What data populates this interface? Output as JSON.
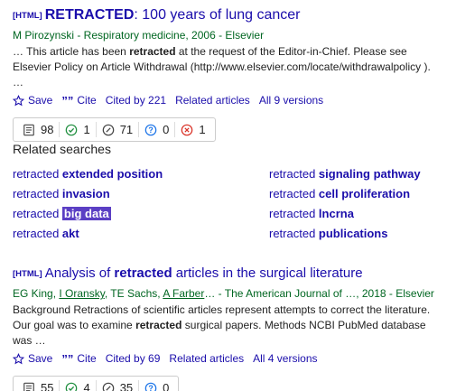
{
  "result1": {
    "tag": "[HTML]",
    "title_bold": "RETRACTED",
    "title_rest": ": 100 years of lung cancer",
    "meta": "M Pirozynski - Respiratory medicine, 2006 - Elsevier",
    "snippet_a": "… This article has been ",
    "snippet_bold": "retracted",
    "snippet_b": " at the request of the Editor-in-Chief. Please see Elsevier Policy on Article Withdrawal (http://www.elsevier.com/locate/withdrawalpolicy ). …",
    "save": "Save",
    "cite": "Cite",
    "cited_by": "Cited by 221",
    "related": "Related articles",
    "versions": "All 9 versions",
    "badges": [
      "98",
      "1",
      "71",
      "0",
      "1"
    ]
  },
  "related_searches": {
    "heading": "Related searches",
    "items": [
      {
        "prefix": "retracted ",
        "term": "extended position"
      },
      {
        "prefix": "retracted ",
        "term": "signaling pathway"
      },
      {
        "prefix": "retracted ",
        "term": "invasion"
      },
      {
        "prefix": "retracted ",
        "term": "cell proliferation"
      },
      {
        "prefix": "retracted ",
        "term": "big data"
      },
      {
        "prefix": "retracted ",
        "term": "lncrna"
      },
      {
        "prefix": "retracted ",
        "term": "akt"
      },
      {
        "prefix": "retracted ",
        "term": "publications"
      }
    ]
  },
  "result2": {
    "tag": "[HTML]",
    "title_a": "Analysis of ",
    "title_bold": "retracted",
    "title_b": " articles in the surgical literature",
    "meta_a": "EG King, ",
    "author2": "I Oransky",
    "meta_b": ", TE Sachs, ",
    "author4": "A Farber",
    "meta_c": "… - The American Journal of …, 2018 - Elsevier",
    "snippet_a": "Background Retractions of scientific articles represent attempts to correct the literature. Our goal was to examine ",
    "snippet_bold": "retracted",
    "snippet_b": " surgical papers. Methods NCBI PubMed database was …",
    "save": "Save",
    "cite": "Cite",
    "cited_by": "Cited by 69",
    "related": "Related articles",
    "versions": "All 4 versions",
    "badges": [
      "55",
      "4",
      "35",
      "0"
    ]
  },
  "colors": {
    "link": "#1a0dab",
    "meta_green": "#006621",
    "highlight": "#5b3fc4",
    "check_green": "#1e8e3e",
    "question_blue": "#1a73e8",
    "x_red": "#d93025"
  },
  "icons": [
    "star-icon",
    "quote-icon",
    "document-icon",
    "check-circle-icon",
    "clock-circle-icon",
    "question-circle-icon",
    "x-circle-icon"
  ]
}
